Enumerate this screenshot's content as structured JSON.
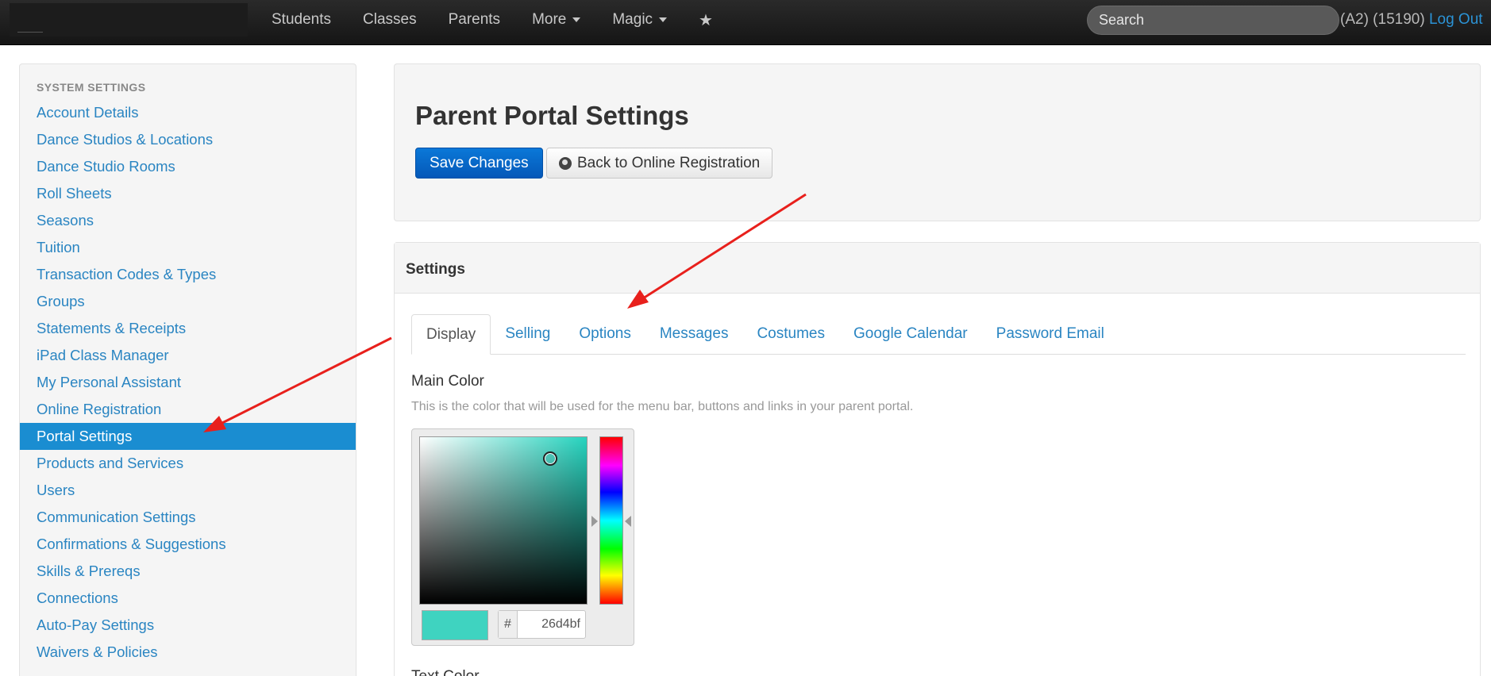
{
  "nav": {
    "items": [
      {
        "label": "Students"
      },
      {
        "label": "Classes"
      },
      {
        "label": "Parents"
      },
      {
        "label": "More"
      },
      {
        "label": "Magic"
      }
    ],
    "star_icon": "star-icon",
    "search_placeholder": "Search",
    "user_info": "(A2) (15190)",
    "logout_label": "Log Out"
  },
  "sidebar": {
    "header": "SYSTEM SETTINGS",
    "items": [
      "Account Details",
      "Dance Studios & Locations",
      "Dance Studio Rooms",
      "Roll Sheets",
      "Seasons",
      "Tuition",
      "Transaction Codes & Types",
      "Groups",
      "Statements & Receipts",
      "iPad Class Manager",
      "My Personal Assistant",
      "Online Registration",
      "Portal Settings",
      "Products and Services",
      "Users",
      "Communication Settings",
      "Confirmations & Suggestions",
      "Skills & Prereqs",
      "Connections",
      "Auto-Pay Settings",
      "Waivers & Policies"
    ],
    "active_index": 12
  },
  "page": {
    "title": "Parent Portal Settings",
    "save_label": "Save Changes",
    "back_label": "Back to Online Registration",
    "back_icon": "globe-icon"
  },
  "settings": {
    "title": "Settings",
    "tabs": [
      "Display",
      "Selling",
      "Options",
      "Messages",
      "Costumes",
      "Google Calendar",
      "Password Email"
    ],
    "active_tab": 0,
    "main_color_label": "Main Color",
    "main_color_help": "This is the color that will be used for the menu bar, buttons and links in your parent portal.",
    "hash_symbol": "#",
    "main_color_hex": "26d4bf",
    "text_color_label": "Text Color"
  },
  "colors": {
    "accent": "#1a8dd1",
    "link": "#2a85c2",
    "primary_button": "#0a6fd0",
    "annotation_arrow": "#e8201c",
    "main_color": "#26d4bf"
  }
}
